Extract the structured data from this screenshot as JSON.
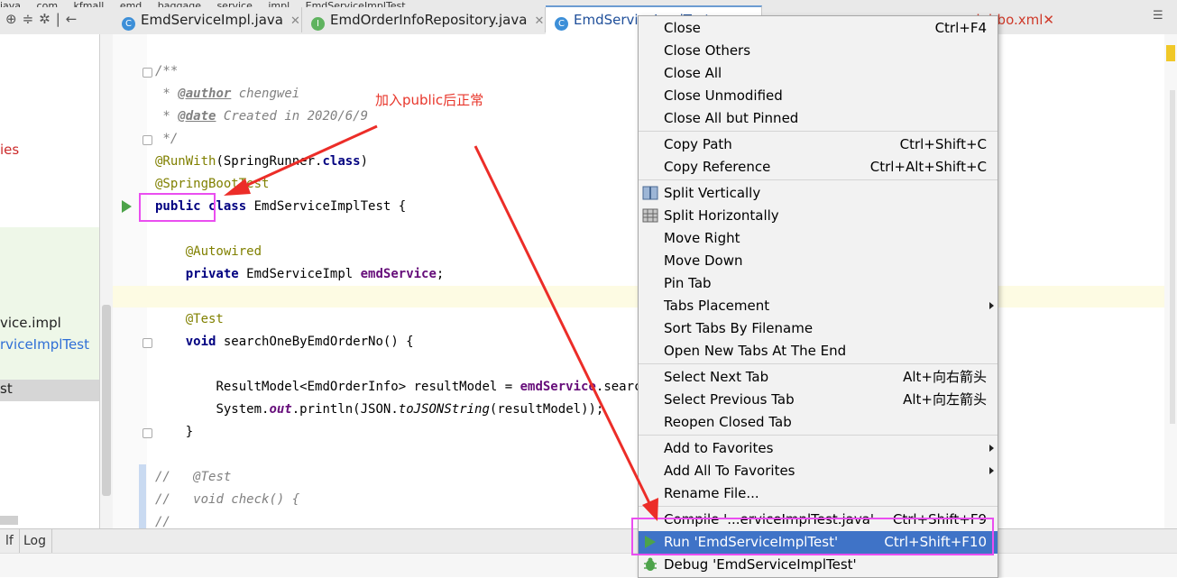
{
  "window": {
    "breadcrumb": [
      "java",
      "com",
      "kfmall",
      "emd",
      "baggage",
      "service",
      "impl",
      "EmdServiceImplTest"
    ]
  },
  "tabs": [
    {
      "label": "EmdServiceImpl.java",
      "icon": "class-icon"
    },
    {
      "label": "EmdOrderInfoRepository.java",
      "icon": "interface-icon"
    },
    {
      "label": "EmdServiceImplTest",
      "icon": "class-icon"
    },
    {
      "label": "dubbo.xml",
      "icon": "xml-icon"
    }
  ],
  "sidebar": {
    "items": [
      {
        "label": "ies",
        "color": "#cc2b2b"
      },
      {
        "label": "vice.impl",
        "color": "#222222"
      },
      {
        "label": "rviceImplTest",
        "color": "#2f6fd6"
      },
      {
        "label": "st",
        "color": "#222222"
      }
    ]
  },
  "editor": {
    "author_tag": "@author",
    "author_name": "chengwei",
    "date_tag": "@date",
    "date_value": "Created in 2020/6/9",
    "runwith": "@RunWith",
    "runwith_arg": "SpringRunner",
    "class_kw": "class",
    "springboottest": "@SpringBootTest",
    "kw_public": "public",
    "kw_class": "class",
    "class_name": "EmdServiceImplTest",
    "autowired": "@Autowired",
    "kw_private": "private",
    "field_type": "EmdServiceImpl",
    "field_name": "emdService",
    "test_anno": "@Test",
    "kw_void": "void",
    "method_name": "searchOneByEmdOrderNo",
    "result_type": "ResultModel<EmdOrderInfo> resultModel = ",
    "call_tail": ".searchO",
    "sys_prefix": "System.",
    "out": "out",
    "println": ".println(JSON.",
    "tojson": "toJSONString",
    "println_tail": "(resultModel));",
    "c1_test": "@Test",
    "c2_check": "void check() {"
  },
  "annotation": {
    "text": "加入public后正常",
    "color": "#e8362b",
    "box_color": "#ea4ef0"
  },
  "context_menu": {
    "groups": [
      [
        {
          "label": "Close",
          "shortcut": "Ctrl+F4"
        },
        {
          "label": "Close Others",
          "shortcut": ""
        },
        {
          "label": "Close All",
          "shortcut": ""
        },
        {
          "label": "Close Unmodified",
          "shortcut": ""
        },
        {
          "label": "Close All but Pinned",
          "shortcut": ""
        }
      ],
      [
        {
          "label": "Copy Path",
          "shortcut": "Ctrl+Shift+C"
        },
        {
          "label": "Copy Reference",
          "shortcut": "Ctrl+Alt+Shift+C"
        }
      ],
      [
        {
          "label": "Split Vertically",
          "shortcut": "",
          "icon": "split-vertical-icon"
        },
        {
          "label": "Split Horizontally",
          "shortcut": "",
          "icon": "split-horizontal-icon"
        },
        {
          "label": "Move Right",
          "shortcut": ""
        },
        {
          "label": "Move Down",
          "shortcut": ""
        },
        {
          "label": "Pin Tab",
          "shortcut": ""
        },
        {
          "label": "Tabs Placement",
          "shortcut": "",
          "submenu": true
        },
        {
          "label": "Sort Tabs By Filename",
          "shortcut": ""
        },
        {
          "label": "Open New Tabs At The End",
          "shortcut": ""
        }
      ],
      [
        {
          "label": "Select Next Tab",
          "shortcut": "Alt+向右箭头"
        },
        {
          "label": "Select Previous Tab",
          "shortcut": "Alt+向左箭头"
        },
        {
          "label": "Reopen Closed Tab",
          "shortcut": ""
        }
      ],
      [
        {
          "label": "Add to Favorites",
          "shortcut": "",
          "submenu": true
        },
        {
          "label": "Add All To Favorites",
          "shortcut": "",
          "submenu": true
        },
        {
          "label": "Rename File...",
          "shortcut": ""
        }
      ],
      [
        {
          "label": "Compile '...erviceImplTest.java'",
          "shortcut": "Ctrl+Shift+F9"
        },
        {
          "label": "Run 'EmdServiceImplTest'",
          "shortcut": "Ctrl+Shift+F10",
          "icon": "run-icon",
          "selected": true
        },
        {
          "label": "Debug 'EmdServiceImplTest'",
          "shortcut": "",
          "icon": "debug-icon"
        }
      ]
    ]
  },
  "statusbar": {
    "tabs": [
      "lf",
      "Log"
    ]
  },
  "colors": {
    "menu_selected": "#3f73c7",
    "run_green": "#4da34a"
  }
}
